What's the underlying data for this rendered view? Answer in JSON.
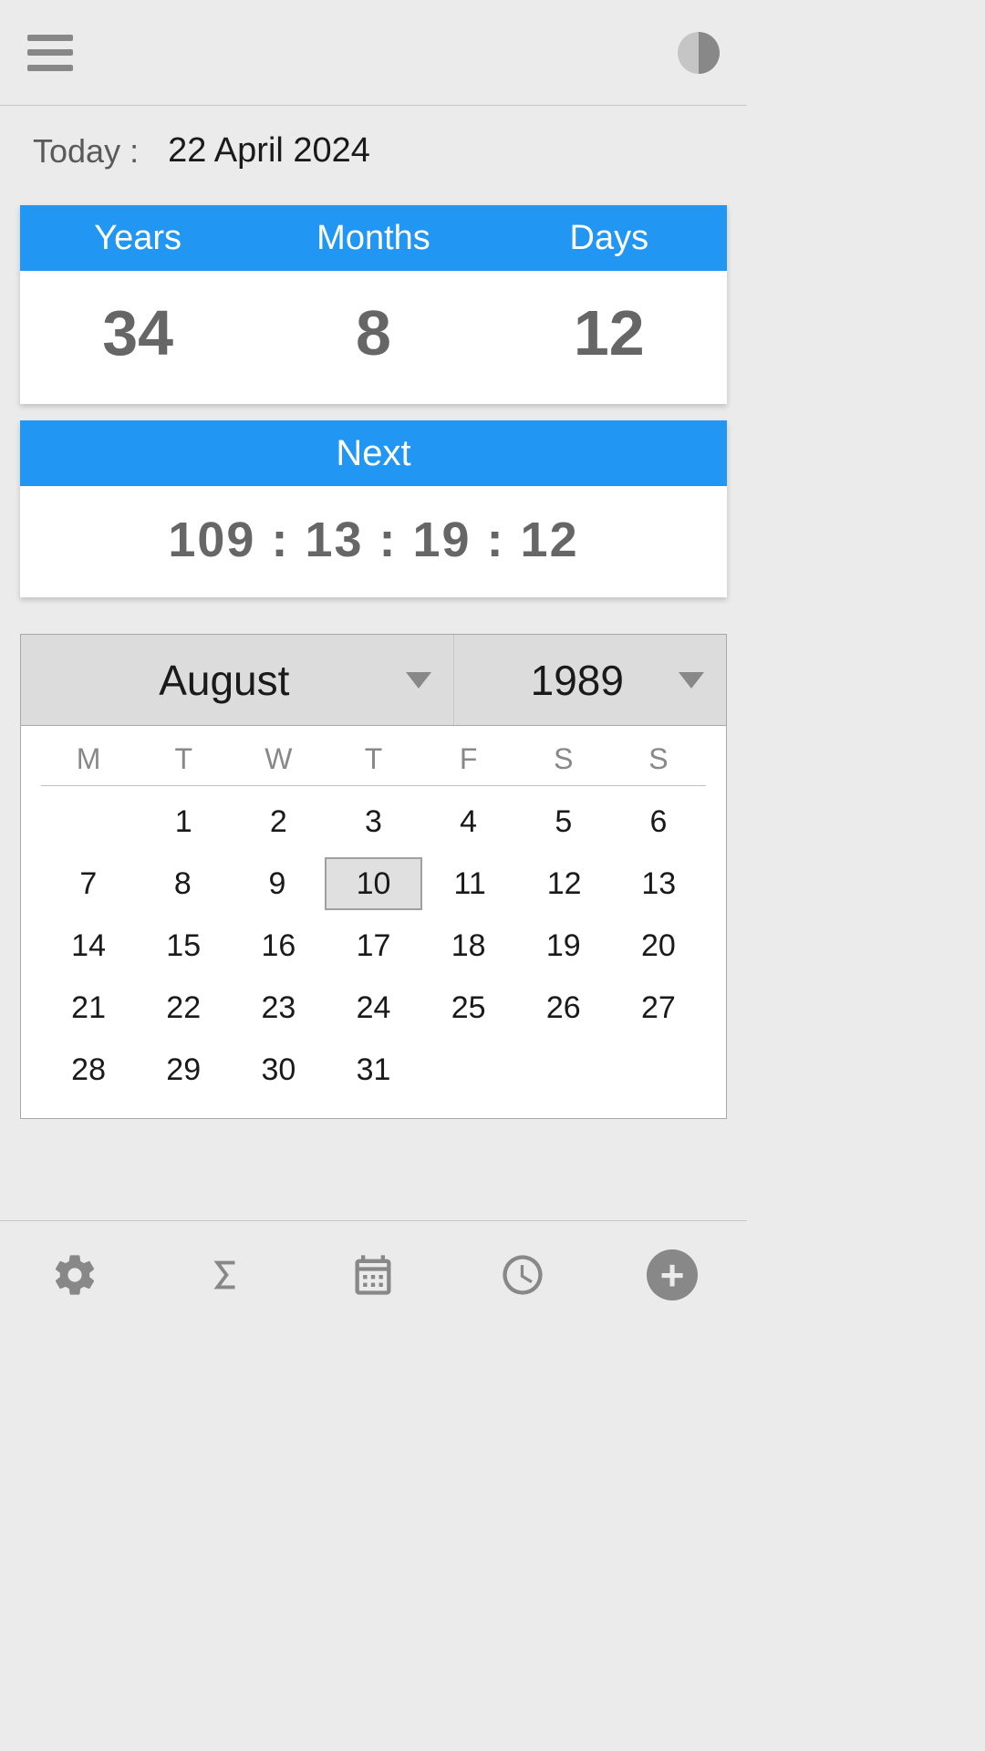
{
  "today": {
    "label": "Today :",
    "date": "22 April 2024"
  },
  "age": {
    "headers": [
      "Years",
      "Months",
      "Days"
    ],
    "values": [
      "34",
      "8",
      "12"
    ]
  },
  "next": {
    "header": "Next",
    "countdown": "109 : 13 : 19 : 12"
  },
  "calendar": {
    "month": "August",
    "year": "1989",
    "weekdays": [
      "M",
      "T",
      "W",
      "T",
      "F",
      "S",
      "S"
    ],
    "selected_day": "10",
    "weeks": [
      [
        "",
        "1",
        "2",
        "3",
        "4",
        "5",
        "6"
      ],
      [
        "7",
        "8",
        "9",
        "10",
        "11",
        "12",
        "13"
      ],
      [
        "14",
        "15",
        "16",
        "17",
        "18",
        "19",
        "20"
      ],
      [
        "21",
        "22",
        "23",
        "24",
        "25",
        "26",
        "27"
      ],
      [
        "28",
        "29",
        "30",
        "31",
        "",
        "",
        ""
      ]
    ]
  }
}
